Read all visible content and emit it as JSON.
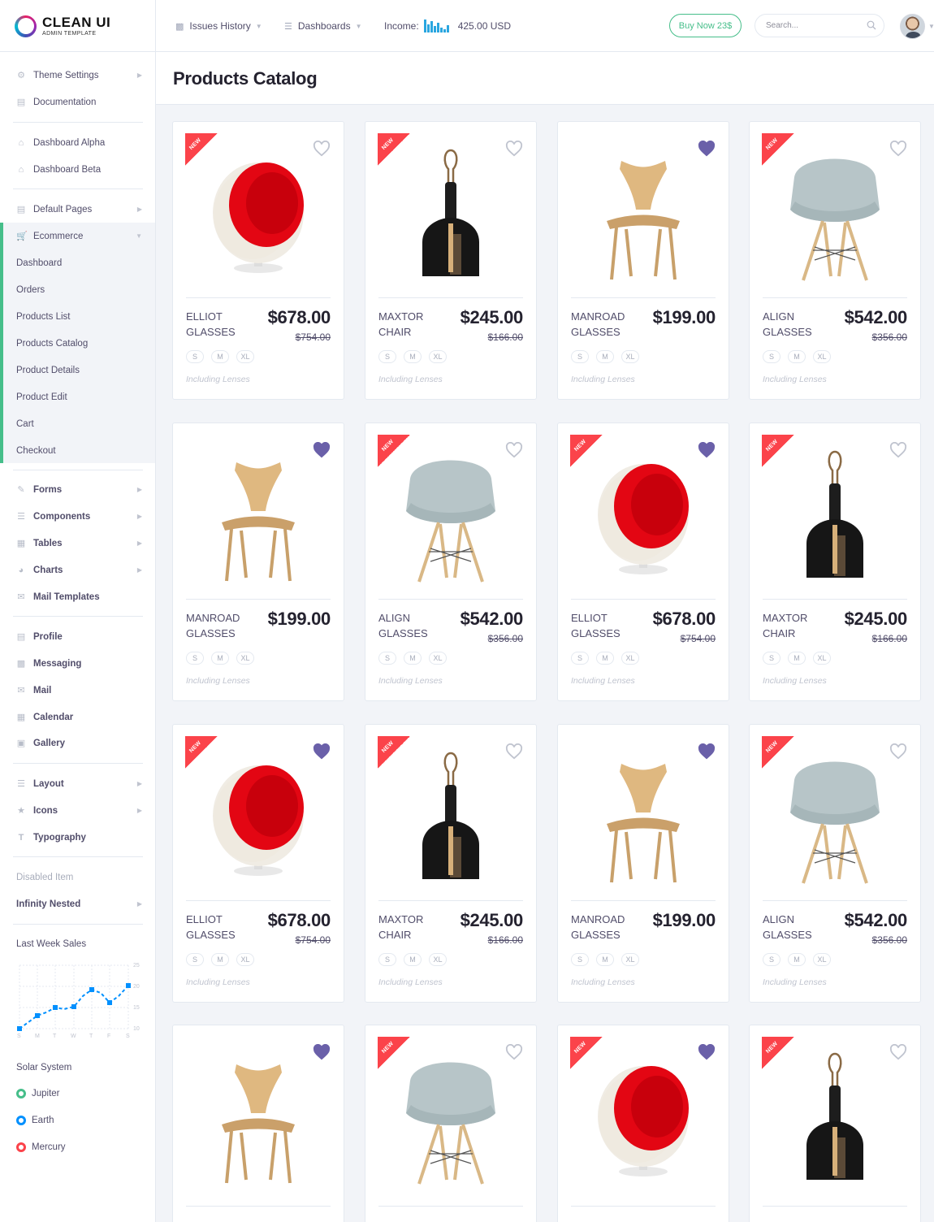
{
  "app": {
    "logo_title": "CLEAN UI",
    "logo_sub": "ADMIN TEMPLATE"
  },
  "topbar": {
    "menu1": "Issues History",
    "menu2": "Dashboards",
    "income_label": "Income:",
    "income_value": "425.00 USD",
    "buy_label": "Buy Now 23$",
    "search_placeholder": "Search..."
  },
  "sidebar": {
    "theme_settings": "Theme Settings",
    "documentation": "Documentation",
    "dashboard_alpha": "Dashboard Alpha",
    "dashboard_beta": "Dashboard Beta",
    "default_pages": "Default Pages",
    "ecommerce": "Ecommerce",
    "ecommerce_items": [
      "Dashboard",
      "Orders",
      "Products List",
      "Products Catalog",
      "Product Details",
      "Product Edit",
      "Cart",
      "Checkout"
    ],
    "forms": "Forms",
    "components": "Components",
    "tables": "Tables",
    "charts": "Charts",
    "mail_templates": "Mail Templates",
    "profile": "Profile",
    "messaging": "Messaging",
    "mail": "Mail",
    "calendar": "Calendar",
    "gallery": "Gallery",
    "layout": "Layout",
    "icons": "Icons",
    "typography": "Typography",
    "disabled_item": "Disabled Item",
    "infinity_nested": "Infinity Nested",
    "last_week_sales": "Last Week Sales",
    "chart_days": [
      "S",
      "M",
      "T",
      "W",
      "T",
      "F",
      "S"
    ],
    "chart_ticks": [
      "25",
      "20",
      "15",
      "10"
    ],
    "solar_system": "Solar System",
    "planets": [
      {
        "name": "Jupiter",
        "color": "#46be8a"
      },
      {
        "name": "Earth",
        "color": "#0190fe"
      },
      {
        "name": "Mercury",
        "color": "#fb434a"
      }
    ]
  },
  "page": {
    "title": "Products Catalog"
  },
  "sizes": [
    "S",
    "M",
    "XL"
  ],
  "card_note": "Including Lenses",
  "new_tag": "NEW",
  "products": [
    {
      "name": "ELLIOT GLASSES",
      "price": "$678.00",
      "old": "$754.00",
      "img": "egg-chair",
      "isNew": true,
      "fav": false
    },
    {
      "name": "MAXTOR CHAIR",
      "price": "$245.00",
      "old": "$166.00",
      "img": "dustpan",
      "isNew": true,
      "fav": false
    },
    {
      "name": "MANROAD GLASSES",
      "price": "$199.00",
      "old": "",
      "img": "wood-chair",
      "isNew": false,
      "fav": true
    },
    {
      "name": "ALIGN GLASSES",
      "price": "$542.00",
      "old": "$356.00",
      "img": "shell-chair",
      "isNew": true,
      "fav": false
    },
    {
      "name": "MANROAD GLASSES",
      "price": "$199.00",
      "old": "",
      "img": "wood-chair",
      "isNew": false,
      "fav": true
    },
    {
      "name": "ALIGN GLASSES",
      "price": "$542.00",
      "old": "$356.00",
      "img": "shell-chair",
      "isNew": true,
      "fav": false
    },
    {
      "name": "ELLIOT GLASSES",
      "price": "$678.00",
      "old": "$754.00",
      "img": "egg-chair",
      "isNew": true,
      "fav": true
    },
    {
      "name": "MAXTOR CHAIR",
      "price": "$245.00",
      "old": "$166.00",
      "img": "dustpan",
      "isNew": true,
      "fav": false
    },
    {
      "name": "ELLIOT GLASSES",
      "price": "$678.00",
      "old": "$754.00",
      "img": "egg-chair",
      "isNew": true,
      "fav": true
    },
    {
      "name": "MAXTOR CHAIR",
      "price": "$245.00",
      "old": "$166.00",
      "img": "dustpan",
      "isNew": true,
      "fav": false
    },
    {
      "name": "MANROAD GLASSES",
      "price": "$199.00",
      "old": "",
      "img": "wood-chair",
      "isNew": false,
      "fav": true
    },
    {
      "name": "ALIGN GLASSES",
      "price": "$542.00",
      "old": "$356.00",
      "img": "shell-chair",
      "isNew": true,
      "fav": false
    },
    {
      "name": "",
      "price": "",
      "old": "",
      "img": "wood-chair",
      "isNew": false,
      "fav": true
    },
    {
      "name": "",
      "price": "",
      "old": "",
      "img": "shell-chair",
      "isNew": true,
      "fav": false
    },
    {
      "name": "",
      "price": "",
      "old": "",
      "img": "egg-chair",
      "isNew": true,
      "fav": true
    },
    {
      "name": "",
      "price": "",
      "old": "",
      "img": "dustpan",
      "isNew": true,
      "fav": false
    }
  ],
  "colors": {
    "accent": "#46be8a",
    "favorite": "#6a60a9",
    "new_tag": "#fb434a",
    "income_bars": "#2aa6e0",
    "chart_line": "#0190fe"
  }
}
